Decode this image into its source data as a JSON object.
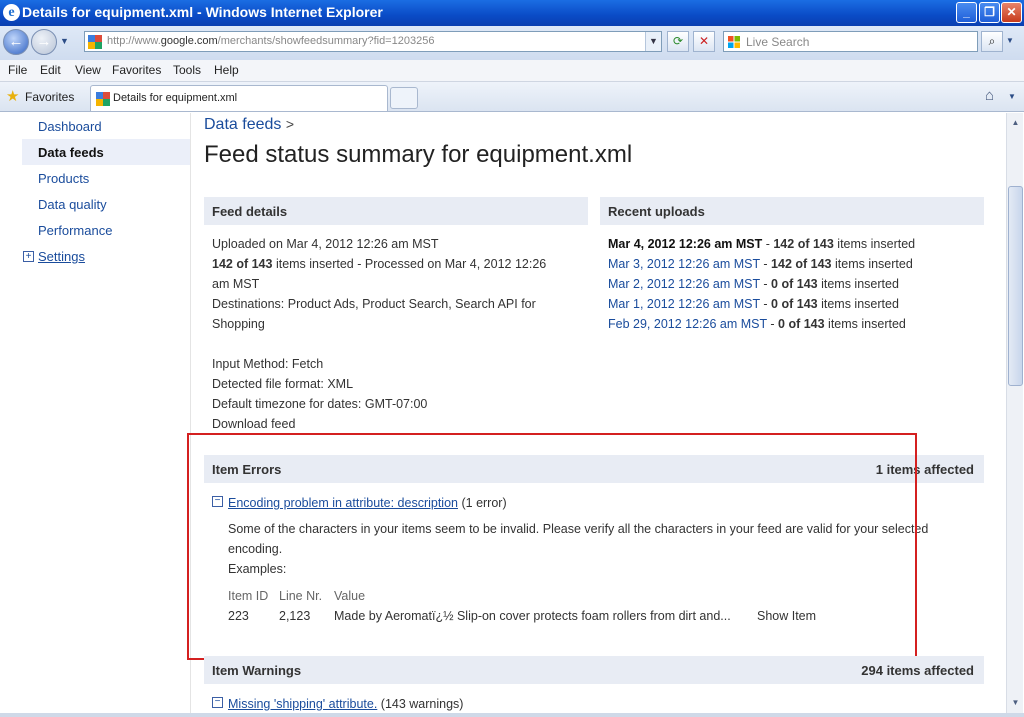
{
  "window": {
    "title": "Details for equipment.xml - Windows Internet Explorer"
  },
  "address": {
    "url_prefix": "http://www.",
    "url_domain": "google.com",
    "url_suffix": "/merchants/showfeedsummary?fid=1203256"
  },
  "search": {
    "placeholder": "Live Search"
  },
  "menu": [
    "File",
    "Edit",
    "View",
    "Favorites",
    "Tools",
    "Help"
  ],
  "favorites": {
    "label": "Favorites",
    "tab_title": "Details for equipment.xml"
  },
  "sidebar": {
    "items": [
      {
        "label": "Dashboard"
      },
      {
        "label": "Data feeds"
      },
      {
        "label": "Products"
      },
      {
        "label": "Data quality"
      },
      {
        "label": "Performance"
      },
      {
        "label": "Settings"
      }
    ]
  },
  "breadcrumb": {
    "link": "Data feeds",
    "sep": ">"
  },
  "page_title": "Feed status summary for equipment.xml",
  "feed_details": {
    "heading": "Feed details",
    "uploaded": "Uploaded on Mar 4, 2012 12:26 am MST",
    "inserted_bold": "142 of 143",
    "inserted_rest": " items inserted - Processed on Mar 4, 2012 12:26",
    "inserted_rest2": "am MST",
    "destinations1": "Destinations: Product Ads, Product Search, Search API for",
    "destinations2": "Shopping",
    "input_method": "Input Method: Fetch",
    "format": "Detected file format: XML",
    "timezone": "Default timezone for dates: GMT-07:00",
    "download": "Download feed"
  },
  "recent_uploads": {
    "heading": "Recent uploads",
    "items": [
      {
        "date": "Mar 4, 2012 12:26 am MST",
        "count": "142 of 143",
        "suffix": " items inserted"
      },
      {
        "date": "Mar 3, 2012 12:26 am MST",
        "count": "142 of 143",
        "suffix": " items inserted"
      },
      {
        "date": "Mar 2, 2012 12:26 am MST",
        "count": "0 of 143",
        "suffix": " items inserted"
      },
      {
        "date": "Mar 1, 2012 12:26 am MST",
        "count": "0 of 143",
        "suffix": " items inserted"
      },
      {
        "date": "Feb 29, 2012 12:26 am MST",
        "count": "0 of 143",
        "suffix": " items inserted"
      }
    ],
    "sep": " - "
  },
  "item_errors": {
    "heading": "Item Errors",
    "affected": "1 items affected",
    "problem": "Encoding problem in attribute: description",
    "problem_count": "(1 error)",
    "desc1": "Some of the characters in your items seem to be invalid. Please verify all the characters in your feed are valid for your selected",
    "desc2": "encoding.",
    "examples": "Examples:",
    "cols": [
      "Item ID",
      "Line Nr.",
      "Value"
    ],
    "row": {
      "id": "223",
      "line": "2,123",
      "value": "Made by Aeromatï¿½ Slip-on cover protects foam rollers from dirt and...",
      "action": "Show Item"
    }
  },
  "item_warnings": {
    "heading": "Item Warnings",
    "affected": "294 items affected",
    "problem": "Missing 'shipping' attribute.",
    "problem_count": "(143 warnings)"
  }
}
